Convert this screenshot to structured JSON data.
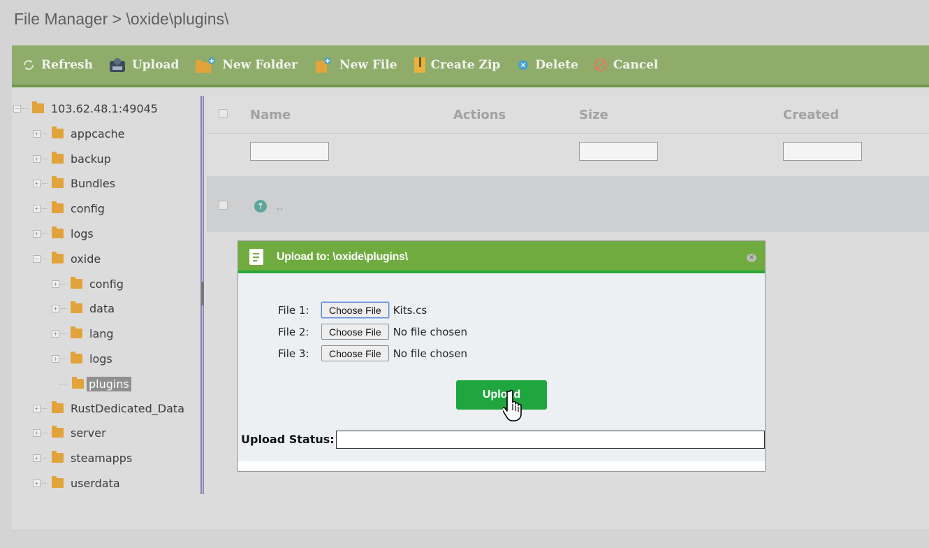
{
  "breadcrumb": "File Manager > \\oxide\\plugins\\",
  "toolbar": {
    "refresh": "Refresh",
    "upload": "Upload",
    "new_folder": "New Folder",
    "new_file": "New File",
    "create_zip": "Create Zip",
    "delete": "Delete",
    "cancel": "Cancel"
  },
  "tree": {
    "root": "103.62.48.1:49045",
    "items": [
      "appcache",
      "backup",
      "Bundles",
      "config",
      "logs",
      "oxide",
      "RustDedicated_Data",
      "server",
      "steamapps",
      "userdata"
    ],
    "oxide_children": [
      "config",
      "data",
      "lang",
      "logs",
      "plugins"
    ],
    "selected": "plugins"
  },
  "grid": {
    "columns": [
      "Name",
      "Actions",
      "Size",
      "Created"
    ],
    "parent_row": ".."
  },
  "dialog": {
    "title": "Upload to: \\oxide\\plugins\\",
    "files": [
      {
        "label": "File 1:",
        "button": "Choose File",
        "value": "Kits.cs"
      },
      {
        "label": "File 2:",
        "button": "Choose File",
        "value": "No file chosen"
      },
      {
        "label": "File 3:",
        "button": "Choose File",
        "value": "No file chosen"
      }
    ],
    "upload_button": "Upload",
    "status_label": "Upload Status:",
    "status_value": ""
  },
  "colors": {
    "toolbar_bg": "#8fac6b",
    "dialog_header": "#6fab3f",
    "upload_button": "#1fa63e",
    "folder": "#e2a33a"
  }
}
